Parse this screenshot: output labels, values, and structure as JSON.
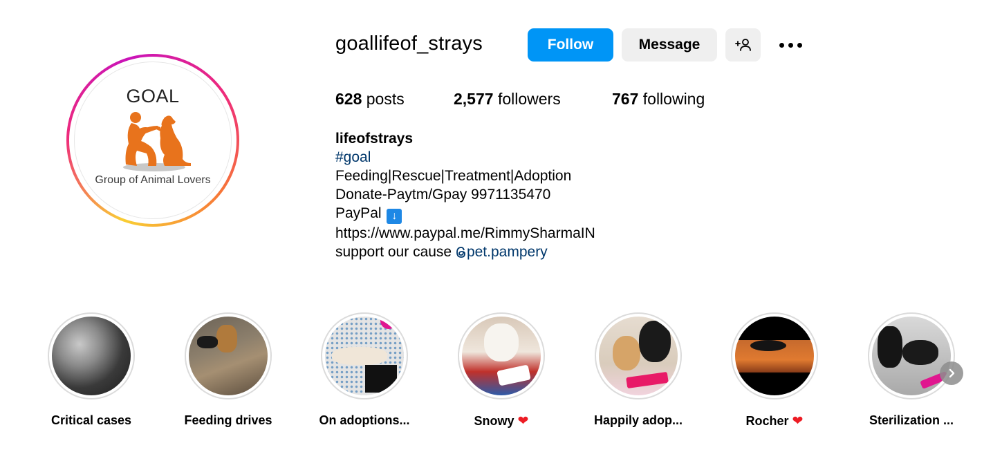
{
  "profile": {
    "username": "goallifeof_strays",
    "logo_title": "GOAL",
    "logo_subtitle": "Group of Animal Lovers"
  },
  "actions": {
    "follow": "Follow",
    "message": "Message",
    "add_user_icon": "person-plus-icon",
    "more_icon": "ellipsis-icon"
  },
  "stats": {
    "posts_count": "628",
    "posts_label": "posts",
    "followers_count": "2,577",
    "followers_label": "followers",
    "following_count": "767",
    "following_label": "following"
  },
  "bio": {
    "name": "lifeofstrays",
    "hashtag": "#goal",
    "line1": "Feeding|Rescue|Treatment|Adoption",
    "line2": "Donate-Paytm/Gpay 9971135470",
    "line3": "PayPal",
    "paypal_arrow": "↓",
    "url": "https://www.paypal.me/RimmySharmaIN",
    "support_text": "support our cause",
    "mention": "pet.pampery"
  },
  "highlights": [
    {
      "label": "Critical cases",
      "heart": ""
    },
    {
      "label": "Feeding drives",
      "heart": ""
    },
    {
      "label": "On adoptions...",
      "heart": ""
    },
    {
      "label": "Snowy",
      "heart": "❤"
    },
    {
      "label": "Happily adop...",
      "heart": ""
    },
    {
      "label": "Rocher",
      "heart": "❤"
    },
    {
      "label": "Sterilization ...",
      "heart": ""
    }
  ],
  "colors": {
    "follow_blue": "#0095f6",
    "link_blue": "#00376b",
    "logo_orange": "#e8731c"
  }
}
